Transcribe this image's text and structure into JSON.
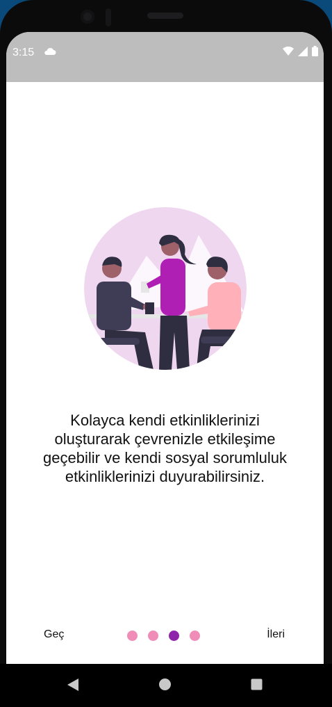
{
  "status_bar": {
    "time": "3:15",
    "icons": [
      "cloud-icon",
      "wifi-icon",
      "signal-icon",
      "battery-icon"
    ]
  },
  "onboarding": {
    "message": "Kolayca kendi etkinliklerinizi\noluşturarak çevrenizle etkileşime\ngeçebilir ve kendi sosyal sorumluluk\netkinliklerinizi duyurabilirsiniz.",
    "skip_label": "Geç",
    "next_label": "İleri",
    "page_indicator": {
      "total": 4,
      "current_index": 2
    }
  },
  "colors": {
    "status_bar": "#bdbdbd",
    "dot_inactive": "#f08cb8",
    "dot_active": "#8e24aa",
    "illustration_bg": "#f0d7f0"
  },
  "nav_bar": {
    "icons": [
      "back-icon",
      "home-icon",
      "recents-icon"
    ]
  }
}
